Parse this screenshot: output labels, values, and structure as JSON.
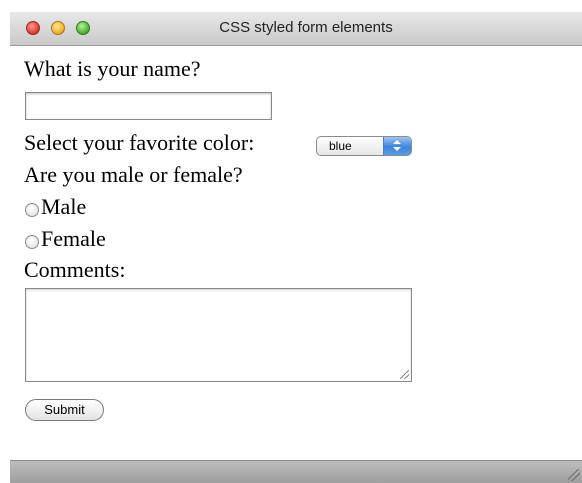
{
  "window": {
    "title": "CSS styled form elements"
  },
  "form": {
    "name_label": "What is your name?",
    "name_value": "",
    "color_label": "Select your favorite color:",
    "color_selected": "blue",
    "gender_label": "Are you male or female?",
    "gender_options": [
      "Male",
      "Female"
    ],
    "comments_label": "Comments:",
    "comments_value": "",
    "submit_label": "Submit"
  },
  "icons": {
    "close": "close-icon",
    "minimize": "minimize-icon",
    "maximize": "maximize-icon",
    "select_arrows": "updown-arrows-icon",
    "resize": "resize-grip-icon"
  },
  "colors": {
    "close": "#e0443a",
    "minimize": "#f3b72f",
    "maximize": "#55b83a",
    "select_accent": "#3b84df"
  }
}
